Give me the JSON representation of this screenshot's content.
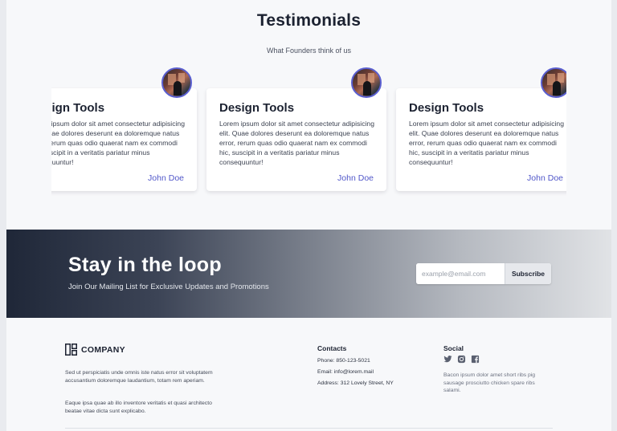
{
  "testimonials": {
    "title": "Testimonials",
    "subtitle": "What Founders think of us",
    "cards": [
      {
        "title": "Design Tools",
        "text": "Lorem ipsum dolor sit amet consectetur adipisicing elit. Quae dolores deserunt ea doloremque natus error, rerum quas odio quaerat nam ex commodi hic, suscipit in a veritatis pariatur minus consequuntur!",
        "author": "John Doe"
      },
      {
        "title": "Design Tools",
        "text": "Lorem ipsum dolor sit amet consectetur adipisicing elit. Quae dolores deserunt ea doloremque natus error, rerum quas odio quaerat nam ex commodi hic, suscipit in a veritatis pariatur minus consequuntur!",
        "author": "John Doe"
      },
      {
        "title": "Design Tools",
        "text": "Lorem ipsum dolor sit amet consectetur adipisicing elit. Quae dolores deserunt ea doloremque natus error, rerum quas odio quaerat nam ex commodi hic, suscipit in a veritatis pariatur minus consequuntur!",
        "author": "John Doe"
      }
    ]
  },
  "newsletter": {
    "title": "Stay in the loop",
    "subtitle": "Join Our Mailing List for Exclusive Updates and Promotions",
    "email_placeholder": "example@email.com",
    "subscribe_label": "Subscribe"
  },
  "footer": {
    "company": "COMPANY",
    "about_1": "Sed ut perspiciatis unde omnis iste natus error sit voluptatem accusantium doloremque laudantium, totam rem aperiam.",
    "about_2": "Eaque ipsa quae ab illo inventore veritatis et quasi architecto beatae vitae dicta sunt explicabo.",
    "contacts_heading": "Contacts",
    "phone": "Phone: 850-123-5021",
    "email": "Email: info@lorem.mail",
    "address": "Address: 312 Lovely Street, NY",
    "social_heading": "Social",
    "social_icons": [
      "twitter-icon",
      "instagram-icon",
      "facebook-icon"
    ],
    "social_text": "Bacon ipsum dolor amet short ribs pig sausage prosciutto chicken spare ribs salami."
  },
  "colors": {
    "accent": "#5157c9",
    "dark": "#1c2231"
  }
}
